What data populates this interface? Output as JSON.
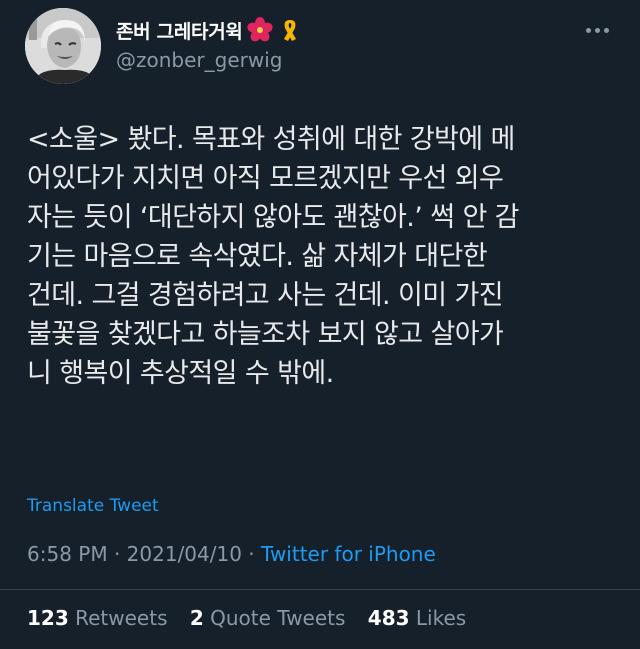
{
  "user": {
    "display_name": "존버 그레타거윅",
    "handle": "@zonber_gerwig",
    "badges": [
      "hibiscus-icon",
      "ribbon-icon"
    ]
  },
  "tweet": {
    "lines": [
      "<소울> 봤다. 목표와 성취에 대한 강박에 메",
      "어있다가 지치면 아직 모르겠지만 우선 외우",
      "자는 듯이 ‘대단하지 않아도 괜찮아.’ 썩 안 감",
      "기는 마음으로 속삭였다. 삶 자체가 대단한",
      "건데. 그걸 경험하려고 사는 건데. 이미 가진",
      "불꽃을 찾겠다고 하늘조차 보지 않고 살아가",
      "니 행복이 추상적일 수 밖에."
    ],
    "translate_label": "Translate Tweet",
    "time": "6:58 PM",
    "sep1": " · ",
    "date": "2021/04/10",
    "sep2": " · ",
    "source": "Twitter for iPhone"
  },
  "stats": {
    "retweets_count": "123",
    "retweets_label": "Retweets",
    "quotes_count": "2",
    "quotes_label": "Quote Tweets",
    "likes_count": "483",
    "likes_label": "Likes"
  },
  "colors": {
    "background": "#15202b",
    "text": "#e7e9ea",
    "muted": "#8b98a5",
    "link": "#1d9bf0"
  }
}
